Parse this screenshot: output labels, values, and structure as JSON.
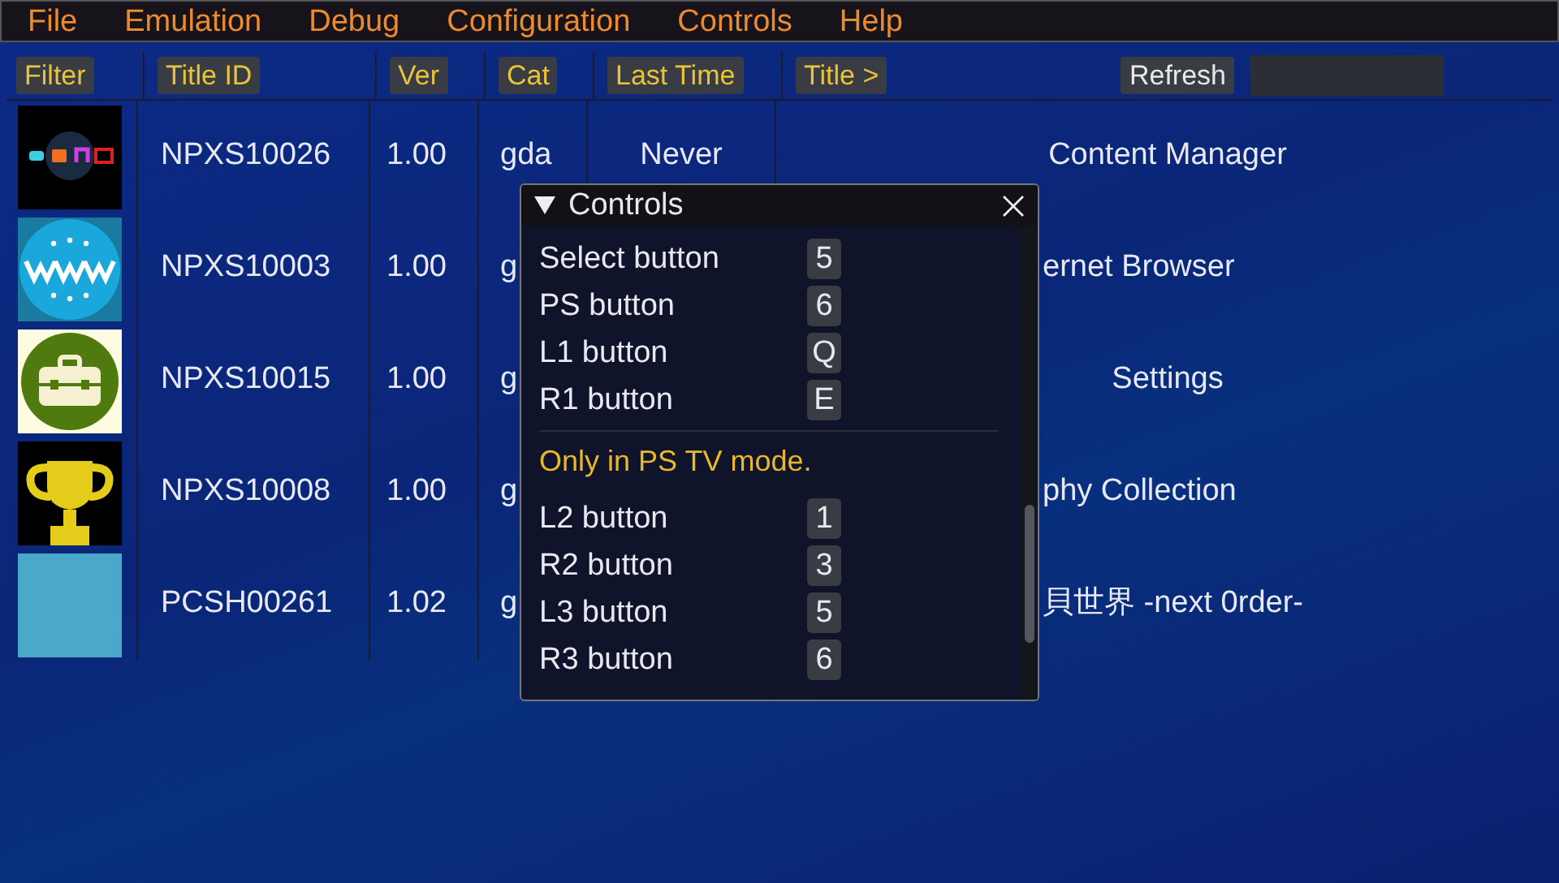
{
  "menu": [
    {
      "label": "File"
    },
    {
      "label": "Emulation"
    },
    {
      "label": "Debug"
    },
    {
      "label": "Configuration"
    },
    {
      "label": "Controls"
    },
    {
      "label": "Help"
    }
  ],
  "columns": [
    {
      "label": "Filter"
    },
    {
      "label": "Title ID"
    },
    {
      "label": "Ver"
    },
    {
      "label": "Cat"
    },
    {
      "label": "Last Time"
    },
    {
      "label": "Title >"
    }
  ],
  "refresh": "Refresh",
  "rows": [
    {
      "kind": "media",
      "title_id": "NPXS10026",
      "ver": "1.00",
      "cat": "gda",
      "last_time": "Never",
      "title": "Content Manager",
      "covered": false
    },
    {
      "kind": "web",
      "title_id": "NPXS10003",
      "ver": "1.00",
      "cat": "g",
      "title": "ernet Browser",
      "covered": true
    },
    {
      "kind": "toolbox",
      "title_id": "NPXS10015",
      "ver": "1.00",
      "cat": "g",
      "title": "Settings",
      "covered": false
    },
    {
      "kind": "trophy",
      "title_id": "NPXS10008",
      "ver": "1.00",
      "cat": "g",
      "title": "phy Collection",
      "covered": true
    },
    {
      "kind": "photo",
      "title_id": "PCSH00261",
      "ver": "1.02",
      "cat": "g",
      "title": "貝世界 -next 0rder-",
      "covered": true
    }
  ],
  "controls_window": {
    "title": "Controls",
    "items": [
      {
        "kind": "binding",
        "label": "Select button",
        "key": "5"
      },
      {
        "kind": "binding",
        "label": "PS button",
        "key": "6"
      },
      {
        "kind": "binding",
        "label": "L1 button",
        "key": "Q"
      },
      {
        "kind": "binding",
        "label": "R1 button",
        "key": "E"
      },
      {
        "kind": "note",
        "label": "Only in PS TV mode."
      },
      {
        "kind": "binding",
        "label": "L2 button",
        "key": "1"
      },
      {
        "kind": "binding",
        "label": "R2 button",
        "key": "3"
      },
      {
        "kind": "binding",
        "label": "L3 button",
        "key": "5"
      },
      {
        "kind": "binding",
        "label": "R3 button",
        "key": "6"
      }
    ]
  }
}
